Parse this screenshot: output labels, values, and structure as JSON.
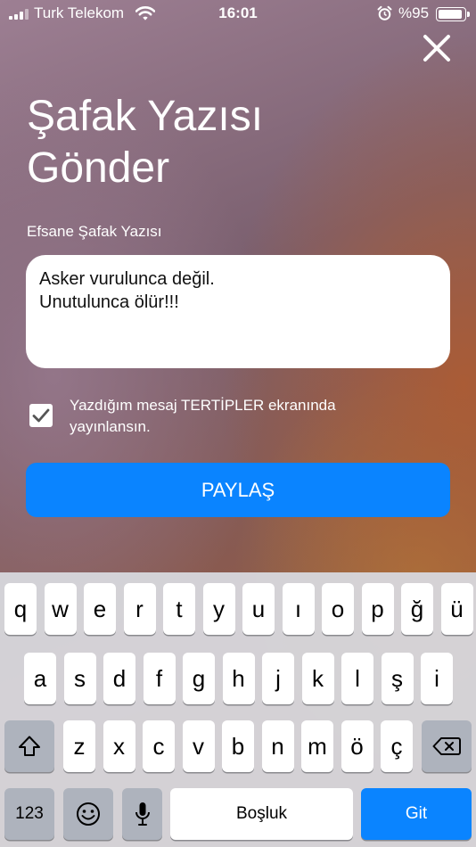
{
  "status_bar": {
    "carrier": "Turk Telekom",
    "time": "16:01",
    "battery": "%95",
    "battery_level": 0.95,
    "icons": [
      "signal-icon",
      "wifi-icon",
      "alarm-icon",
      "battery-icon"
    ]
  },
  "header": {
    "title_line1": "Şafak Yazısı",
    "title_line2": "Gönder",
    "close_icon": "close-icon"
  },
  "form": {
    "label": "Efsane Şafak Yazısı",
    "message": "Asker vurulunca değil.\nUnutulunca ölür!!!",
    "checkbox_checked": true,
    "checkbox_label": "Yazdığım mesaj TERTİPLER ekranında yayınlansın.",
    "share_label": "PAYLAŞ"
  },
  "keyboard": {
    "row1": [
      "q",
      "w",
      "e",
      "r",
      "t",
      "y",
      "u",
      "ı",
      "o",
      "p",
      "ğ",
      "ü"
    ],
    "row2": [
      "a",
      "s",
      "d",
      "f",
      "g",
      "h",
      "j",
      "k",
      "l",
      "ş",
      "i"
    ],
    "row3": [
      "z",
      "x",
      "c",
      "v",
      "b",
      "n",
      "m",
      "ö",
      "ç"
    ],
    "numbers_key": "123",
    "space_key": "Boşluk",
    "go_key": "Git",
    "icons": [
      "shift-icon",
      "backspace-icon",
      "emoji-icon",
      "microphone-icon"
    ]
  },
  "colors": {
    "accent": "#0a84ff",
    "keyboard_bg": "#d6d6dc",
    "dark_key": "#aeb3bd"
  }
}
